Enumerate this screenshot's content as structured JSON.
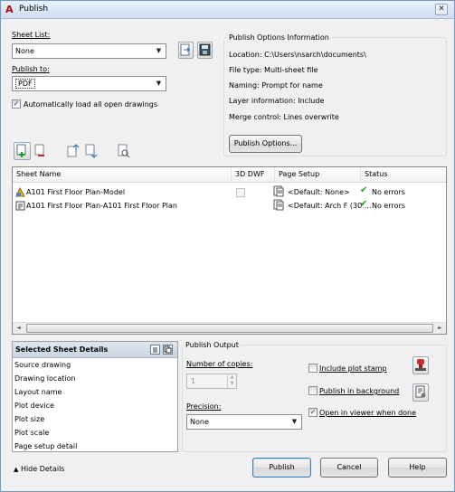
{
  "window": {
    "title": "Publish",
    "close": "✕"
  },
  "sheet_list": {
    "label": "Sheet List:",
    "value": "None"
  },
  "publish_to": {
    "label": "Publish to:",
    "value": "PDF"
  },
  "auto_load": {
    "label": "Automatically load all open drawings",
    "checked": true
  },
  "publish_options": {
    "title": "Publish Options Information",
    "location": "Location: C:\\Users\\nsarch\\documents\\",
    "file_type": "File type: Multi-sheet file",
    "naming": "Naming: Prompt for name",
    "layer_info": "Layer information: Include",
    "merge_control": "Merge control: Lines overwrite",
    "button": "Publish Options..."
  },
  "table": {
    "columns": [
      "Sheet Name",
      "3D DWF",
      "Page Setup",
      "Status"
    ],
    "rows": [
      {
        "name": "A101 First Floor Plan-Model",
        "page_setup": "<Default: None>",
        "status": "No errors"
      },
      {
        "name": "A101 First Floor Plan-A101 First Floor Plan",
        "page_setup": "<Default: Arch F (30 ...",
        "status": "No errors"
      }
    ]
  },
  "selected_details": {
    "title": "Selected Sheet Details",
    "items": [
      "Source drawing",
      "Drawing location",
      "Layout name",
      "Plot device",
      "Plot size",
      "Plot scale",
      "Page setup detail"
    ]
  },
  "publish_output": {
    "title": "Publish Output",
    "copies_label": "Number of copies:",
    "copies_value": "1",
    "precision_label": "Precision:",
    "precision_value": "None",
    "include_plot_stamp": "Include plot stamp",
    "publish_background": "Publish in background",
    "open_in_viewer": "Open in viewer when done"
  },
  "footer": {
    "hide_details": "Hide Details",
    "publish": "Publish",
    "cancel": "Cancel",
    "help": "Help"
  },
  "colors": {
    "ok_green": "#21a121",
    "accent": "#3c7fb1"
  }
}
